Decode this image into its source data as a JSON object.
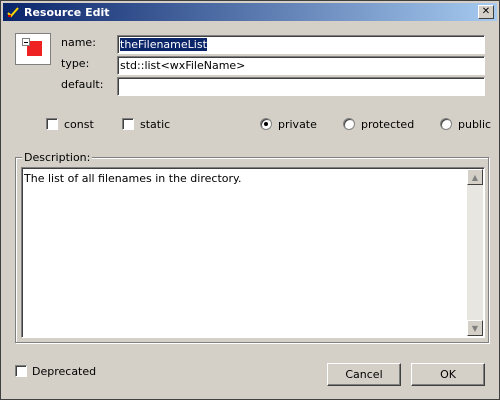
{
  "window": {
    "title": "Resource Edit",
    "close_glyph": "✕"
  },
  "form": {
    "name_label": "name:",
    "name_value": "theFilenameList",
    "type_label": "type:",
    "type_value": "std::list<wxFileName>",
    "default_label": "default:",
    "default_value": ""
  },
  "options": {
    "const_label": "const",
    "static_label": "static",
    "private_label": "private",
    "protected_label": "protected",
    "public_label": "public",
    "selected_access": "private"
  },
  "description": {
    "legend": "Description:",
    "text": "The list of all filenames in the directory."
  },
  "footer": {
    "deprecated_label": "Deprecated",
    "cancel_label": "Cancel",
    "ok_label": "OK"
  },
  "icons": {
    "title": "resource-edit-icon",
    "resource": "resource-icon",
    "scroll_up": "scroll-up-arrow-icon",
    "scroll_down": "scroll-down-arrow-icon"
  }
}
